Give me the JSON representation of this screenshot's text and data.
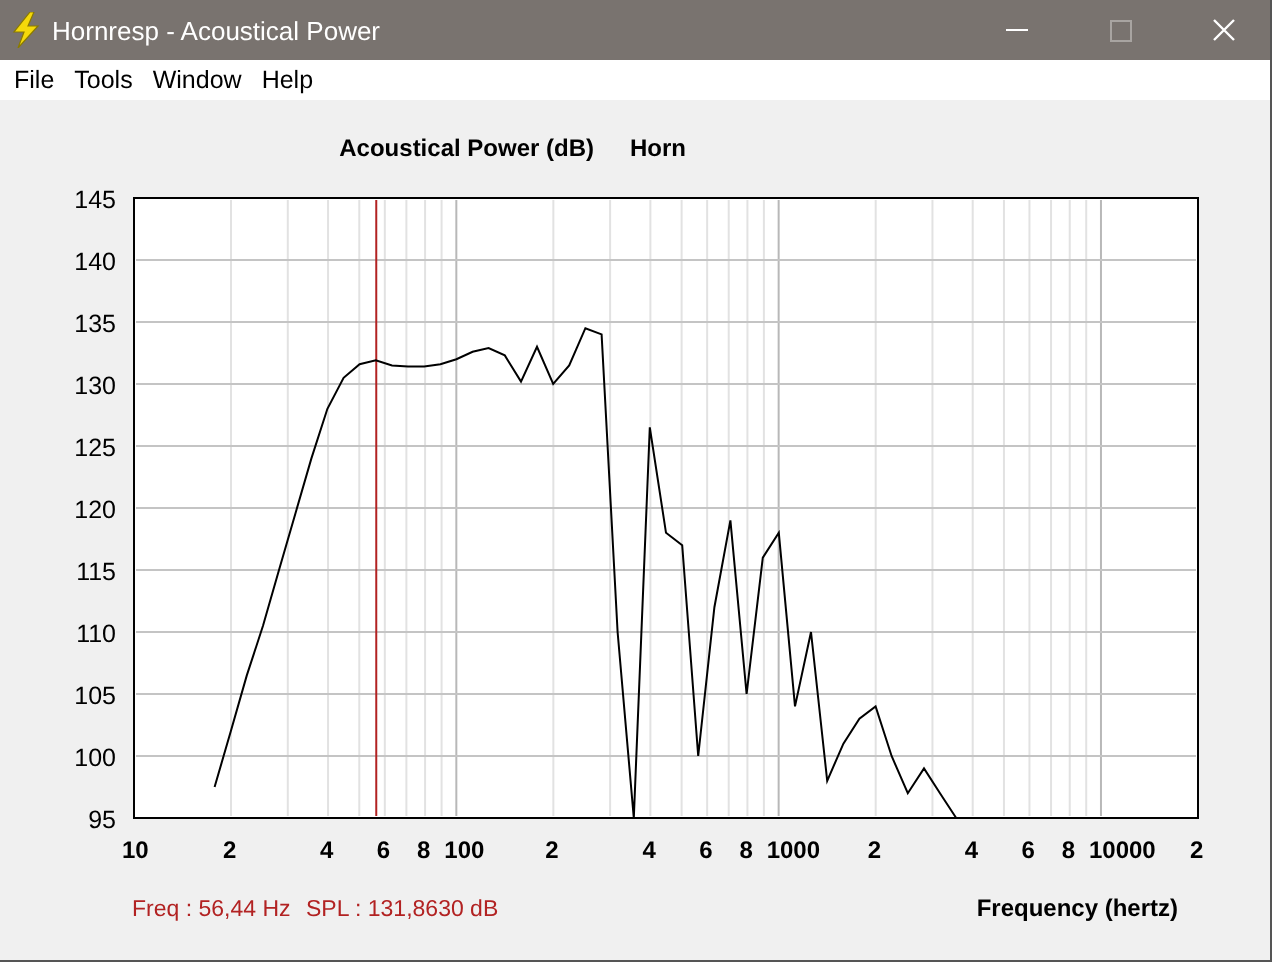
{
  "window": {
    "title": "Hornresp - Acoustical Power",
    "controls": [
      {
        "kind": "minimize",
        "disabled": false
      },
      {
        "kind": "maximize",
        "disabled": true
      },
      {
        "kind": "close",
        "disabled": false
      }
    ]
  },
  "menu": [
    "File",
    "Tools",
    "Window",
    "Help"
  ],
  "plot": {
    "x_axis_labels": [
      "10",
      "2",
      "4",
      "6",
      "8",
      "100",
      "2",
      "4",
      "6",
      "8",
      "1000",
      "2",
      "4",
      "6",
      "8",
      "10000",
      "2"
    ],
    "readouts": [
      "Freq : 56,44 Hz",
      "SPL : 131,8630 dB"
    ],
    "chart_data": {
      "type": "line",
      "title": "Acoustical Power (dB)",
      "xlabel": "Frequency (hertz)",
      "ylim": [
        95,
        145
      ],
      "yticks": [
        95,
        100,
        105,
        110,
        115,
        120,
        125,
        130,
        135,
        140,
        145
      ],
      "grid": true,
      "series": [
        {
          "name": "Horn",
          "color": "#000000",
          "values": [
            null,
            null,
            null,
            null,
            null,
            97.5,
            102,
            106.5,
            110.5,
            115,
            119.5,
            124,
            128,
            130.5,
            131.6,
            131.9,
            131.5,
            131.4,
            131.4,
            131.6,
            132,
            132.6,
            132.9,
            132.3,
            130.2,
            133,
            130,
            131.5,
            134.5,
            134,
            110,
            95,
            126.5,
            118,
            117,
            100,
            112,
            119,
            105,
            116,
            118,
            104,
            110,
            98,
            101,
            103,
            104,
            100,
            97,
            99,
            97,
            95,
            null,
            null,
            null,
            null,
            null,
            null,
            null,
            null,
            null,
            null,
            null,
            null,
            null,
            null,
            null
          ]
        }
      ]
    }
  }
}
